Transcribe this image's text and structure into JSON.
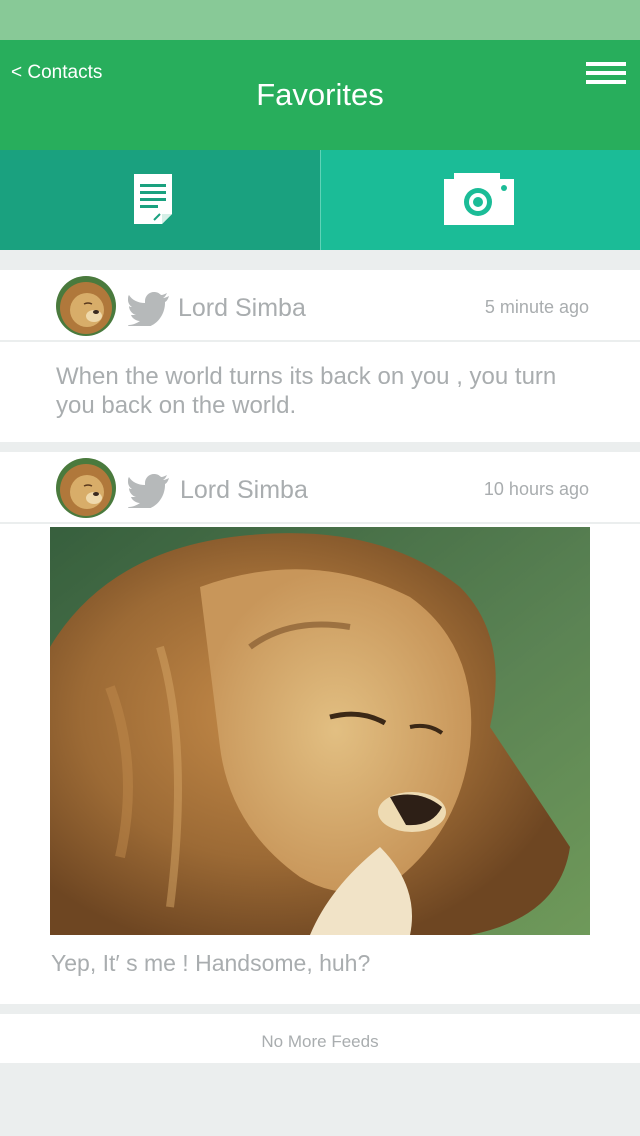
{
  "nav": {
    "back_label": "< Contacts",
    "title": "Favorites",
    "menu_icon": "hamburger-menu-icon"
  },
  "tabs": [
    {
      "name": "notes",
      "icon": "document-icon",
      "active": true
    },
    {
      "name": "camera",
      "icon": "camera-icon",
      "active": false
    }
  ],
  "feed": [
    {
      "author": "Lord Simba",
      "source_icon": "twitter-bird-icon",
      "time": "5 minute ago",
      "text": "When the world turns its back on you , you turn you back on the world."
    },
    {
      "author": "Lord Simba",
      "source_icon": "twitter-bird-icon",
      "time": "10 hours ago",
      "image": "lion-photo",
      "caption": "Yep, It′ s me ! Handsome, huh?"
    }
  ],
  "footer": {
    "label": "No More Feeds"
  },
  "colors": {
    "status_bar": "#88c997",
    "nav_bar": "#28ae5c",
    "tab_active": "#1aa17f",
    "tab_inactive": "#1bbc97",
    "muted_text": "#a9adaf",
    "background": "#ebeeee"
  }
}
